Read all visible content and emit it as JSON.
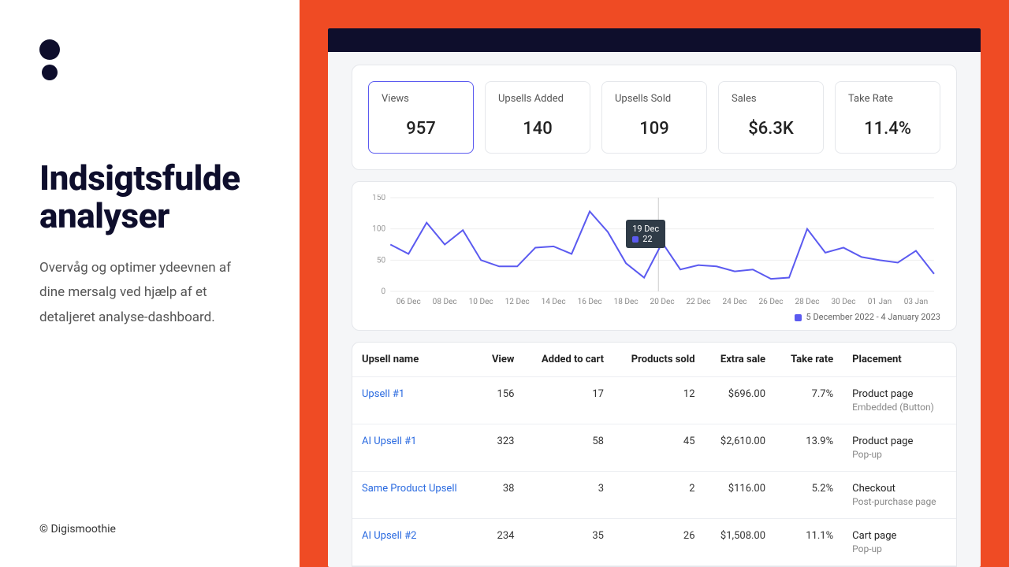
{
  "left": {
    "headline": "Indsigtsfulde analyser",
    "sub": "Overvåg og optimer ydeevnen af dine mersalg ved hjælp af et detaljeret analyse-dashboard.",
    "footer": "© Digismoothie"
  },
  "cards": [
    {
      "label": "Views",
      "value": "957",
      "active": true
    },
    {
      "label": "Upsells Added",
      "value": "140",
      "active": false
    },
    {
      "label": "Upsells Sold",
      "value": "109",
      "active": false
    },
    {
      "label": "Sales",
      "value": "$6.3K",
      "active": false
    },
    {
      "label": "Take Rate",
      "value": "11.4%",
      "active": false
    }
  ],
  "chart_data": {
    "type": "line",
    "title": "",
    "xlabel": "",
    "ylabel": "",
    "ylim": [
      0,
      150
    ],
    "yticks": [
      0,
      50,
      100,
      150
    ],
    "categories": [
      "05 Dec",
      "06 Dec",
      "07 Dec",
      "08 Dec",
      "09 Dec",
      "10 Dec",
      "11 Dec",
      "12 Dec",
      "13 Dec",
      "14 Dec",
      "15 Dec",
      "16 Dec",
      "17 Dec",
      "18 Dec",
      "19 Dec",
      "20 Dec",
      "21 Dec",
      "22 Dec",
      "23 Dec",
      "24 Dec",
      "25 Dec",
      "26 Dec",
      "27 Dec",
      "28 Dec",
      "29 Dec",
      "30 Dec",
      "31 Dec",
      "01 Jan",
      "02 Jan",
      "03 Jan",
      "04 Jan"
    ],
    "xticks": [
      "06 Dec",
      "08 Dec",
      "10 Dec",
      "12 Dec",
      "14 Dec",
      "16 Dec",
      "18 Dec",
      "20 Dec",
      "22 Dec",
      "24 Dec",
      "26 Dec",
      "28 Dec",
      "30 Dec",
      "01 Jan",
      "03 Jan"
    ],
    "values": [
      75,
      60,
      110,
      75,
      98,
      50,
      40,
      40,
      70,
      72,
      60,
      128,
      95,
      45,
      22,
      78,
      35,
      42,
      40,
      32,
      35,
      20,
      22,
      100,
      62,
      70,
      55,
      50,
      46,
      65,
      28
    ],
    "highlight": {
      "index": 14,
      "date": "19 Dec",
      "value": 22
    },
    "legend": "5 December 2022 - 4 January 2023"
  },
  "table": {
    "headers": [
      "Upsell name",
      "View",
      "Added to cart",
      "Products sold",
      "Extra sale",
      "Take rate",
      "Placement"
    ],
    "rows": [
      {
        "name": "Upsell #1",
        "view": "156",
        "added": "17",
        "sold": "12",
        "extra": "$696.00",
        "take": "7.7%",
        "place": "Product page",
        "sub": "Embedded (Button)"
      },
      {
        "name": "AI Upsell #1",
        "view": "323",
        "added": "58",
        "sold": "45",
        "extra": "$2,610.00",
        "take": "13.9%",
        "place": "Product page",
        "sub": "Pop-up"
      },
      {
        "name": "Same Product Upsell",
        "view": "38",
        "added": "3",
        "sold": "2",
        "extra": "$116.00",
        "take": "5.2%",
        "place": "Checkout",
        "sub": "Post-purchase page"
      },
      {
        "name": "AI Upsell #2",
        "view": "234",
        "added": "35",
        "sold": "26",
        "extra": "$1,508.00",
        "take": "11.1%",
        "place": "Cart page",
        "sub": "Pop-up"
      }
    ]
  }
}
